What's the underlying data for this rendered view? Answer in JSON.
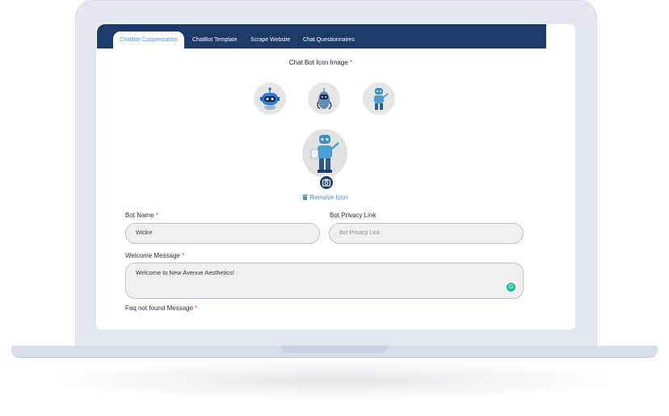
{
  "tabs": [
    {
      "label": "ChatBot Customization",
      "active": true
    },
    {
      "label": "ChatBot Template",
      "active": false
    },
    {
      "label": "Scrape Website",
      "active": false
    },
    {
      "label": "Chat Questionnaires",
      "active": false
    }
  ],
  "icon_section": {
    "title": "Chat Bot Icon Image",
    "required": "*",
    "remove_label": "Remove Icon"
  },
  "form": {
    "bot_name": {
      "label": "Bot Name",
      "required": "*",
      "value": "Wickie"
    },
    "bot_privacy": {
      "label": "Bot Privacy Link",
      "placeholder": "Bot Privacy Link"
    },
    "welcome": {
      "label": "Welcome Message",
      "required": "*",
      "value": "Welcome to New Avenue Aesthetics!"
    },
    "faq_label": "Faq not found Message",
    "faq_required": "*"
  },
  "colors": {
    "tab_bar": "#1d3a6b",
    "accent": "#4a90e2",
    "required": "#e53935"
  }
}
